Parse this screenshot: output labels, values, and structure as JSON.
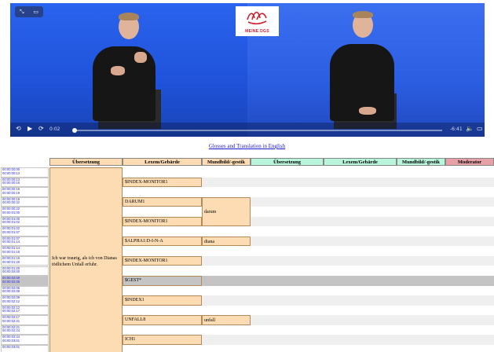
{
  "video": {
    "logo_text": "MEINE DGS",
    "time_current": "0:02",
    "time_remaining": "-6:41",
    "progress_fraction": 0.005
  },
  "gloss_link": "Glosses and Translation in English",
  "headers": {
    "a_translation": "Übersetzung",
    "a_lexeme": "Lexem/Gebärde",
    "a_mouth": "Mundbild/-gestik",
    "b_translation": "Übersetzung",
    "b_lexeme": "Lexem/Gebärde",
    "b_mouth": "Mundbild/-gestik",
    "moderator": "Moderator"
  },
  "colors": {
    "header_a": "#fddcb4",
    "header_b": "#b9f5db",
    "header_moderator": "#e7a0a8",
    "row_alt": "#efefef",
    "row_highlight": "#c4c4c4"
  },
  "timestamps": [
    [
      "00:00:00:00",
      "00:00:00:13"
    ],
    [
      "00:00:00:13",
      "00:00:00:16"
    ],
    [
      "00:00:00:16",
      "00:00:00:19"
    ],
    [
      "00:00:00:19",
      "00:00:00:22"
    ],
    [
      "00:00:00:22",
      "00:00:01:00"
    ],
    [
      "00:00:01:00",
      "00:00:01:02"
    ],
    [
      "00:00:01:02",
      "00:00:01:07"
    ],
    [
      "00:00:01:07",
      "00:00:01:14"
    ],
    [
      "00:00:01:14",
      "00:00:01:18"
    ],
    [
      "00:00:01:18",
      "00:00:01:20"
    ],
    [
      "00:00:01:20",
      "00:00:02:00"
    ],
    [
      "00:00:02:00",
      "00:00:02:06"
    ],
    [
      "00:00:02:06",
      "00:00:02:09"
    ],
    [
      "00:00:02:09",
      "00:00:02:12"
    ],
    [
      "00:00:02:12",
      "00:00:02:17"
    ],
    [
      "00:00:02:17",
      "00:00:02:21"
    ],
    [
      "00:00:02:21",
      "00:00:02:24"
    ],
    [
      "00:00:02:24",
      "00:00:03:01"
    ],
    [
      "00:00:03:01",
      ""
    ]
  ],
  "translation": "Ich war traurig, als ich von Dianas tödlichem Unfall erfuhr.",
  "glosses": [
    {
      "row": 1,
      "text": "$INDEX-MONITOR1"
    },
    {
      "row": 3,
      "text": "DARUM1"
    },
    {
      "row": 5,
      "text": "$INDEX-MONITOR1"
    },
    {
      "row": 7,
      "text": "$ALPHA1:D-I-N-A"
    },
    {
      "row": 9,
      "text": "$INDEX-MONITOR1"
    },
    {
      "row": 11,
      "text": "$GEST*"
    },
    {
      "row": 13,
      "text": "$INDEX1"
    },
    {
      "row": 15,
      "text": "UNFALL8"
    },
    {
      "row": 17,
      "text": "ICH1"
    }
  ],
  "mouthings": [
    {
      "row_start": 3,
      "row_end": 5,
      "text": "darum"
    },
    {
      "row_start": 7,
      "row_end": 7,
      "text": "diana"
    },
    {
      "row_start": 15,
      "row_end": 15,
      "text": "unfall"
    }
  ]
}
